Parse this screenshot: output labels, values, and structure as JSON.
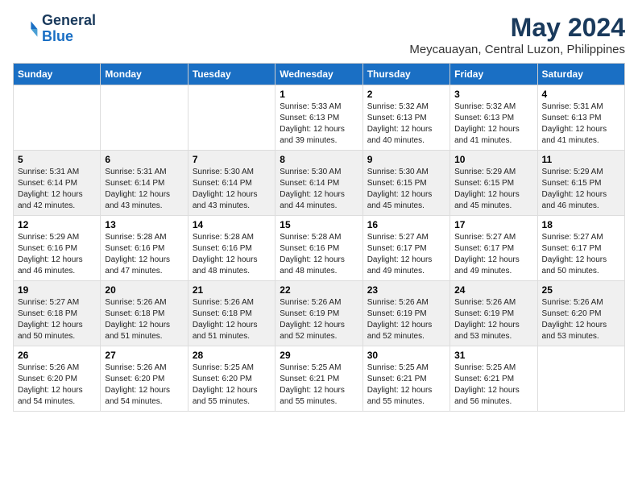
{
  "header": {
    "logo_line1": "General",
    "logo_line2": "Blue",
    "title": "May 2024",
    "subtitle": "Meycauayan, Central Luzon, Philippines"
  },
  "calendar": {
    "weekdays": [
      "Sunday",
      "Monday",
      "Tuesday",
      "Wednesday",
      "Thursday",
      "Friday",
      "Saturday"
    ],
    "rows": [
      [
        {
          "day": "",
          "info": ""
        },
        {
          "day": "",
          "info": ""
        },
        {
          "day": "",
          "info": ""
        },
        {
          "day": "1",
          "info": "Sunrise: 5:33 AM\nSunset: 6:13 PM\nDaylight: 12 hours\nand 39 minutes."
        },
        {
          "day": "2",
          "info": "Sunrise: 5:32 AM\nSunset: 6:13 PM\nDaylight: 12 hours\nand 40 minutes."
        },
        {
          "day": "3",
          "info": "Sunrise: 5:32 AM\nSunset: 6:13 PM\nDaylight: 12 hours\nand 41 minutes."
        },
        {
          "day": "4",
          "info": "Sunrise: 5:31 AM\nSunset: 6:13 PM\nDaylight: 12 hours\nand 41 minutes."
        }
      ],
      [
        {
          "day": "5",
          "info": "Sunrise: 5:31 AM\nSunset: 6:14 PM\nDaylight: 12 hours\nand 42 minutes."
        },
        {
          "day": "6",
          "info": "Sunrise: 5:31 AM\nSunset: 6:14 PM\nDaylight: 12 hours\nand 43 minutes."
        },
        {
          "day": "7",
          "info": "Sunrise: 5:30 AM\nSunset: 6:14 PM\nDaylight: 12 hours\nand 43 minutes."
        },
        {
          "day": "8",
          "info": "Sunrise: 5:30 AM\nSunset: 6:14 PM\nDaylight: 12 hours\nand 44 minutes."
        },
        {
          "day": "9",
          "info": "Sunrise: 5:30 AM\nSunset: 6:15 PM\nDaylight: 12 hours\nand 45 minutes."
        },
        {
          "day": "10",
          "info": "Sunrise: 5:29 AM\nSunset: 6:15 PM\nDaylight: 12 hours\nand 45 minutes."
        },
        {
          "day": "11",
          "info": "Sunrise: 5:29 AM\nSunset: 6:15 PM\nDaylight: 12 hours\nand 46 minutes."
        }
      ],
      [
        {
          "day": "12",
          "info": "Sunrise: 5:29 AM\nSunset: 6:16 PM\nDaylight: 12 hours\nand 46 minutes."
        },
        {
          "day": "13",
          "info": "Sunrise: 5:28 AM\nSunset: 6:16 PM\nDaylight: 12 hours\nand 47 minutes."
        },
        {
          "day": "14",
          "info": "Sunrise: 5:28 AM\nSunset: 6:16 PM\nDaylight: 12 hours\nand 48 minutes."
        },
        {
          "day": "15",
          "info": "Sunrise: 5:28 AM\nSunset: 6:16 PM\nDaylight: 12 hours\nand 48 minutes."
        },
        {
          "day": "16",
          "info": "Sunrise: 5:27 AM\nSunset: 6:17 PM\nDaylight: 12 hours\nand 49 minutes."
        },
        {
          "day": "17",
          "info": "Sunrise: 5:27 AM\nSunset: 6:17 PM\nDaylight: 12 hours\nand 49 minutes."
        },
        {
          "day": "18",
          "info": "Sunrise: 5:27 AM\nSunset: 6:17 PM\nDaylight: 12 hours\nand 50 minutes."
        }
      ],
      [
        {
          "day": "19",
          "info": "Sunrise: 5:27 AM\nSunset: 6:18 PM\nDaylight: 12 hours\nand 50 minutes."
        },
        {
          "day": "20",
          "info": "Sunrise: 5:26 AM\nSunset: 6:18 PM\nDaylight: 12 hours\nand 51 minutes."
        },
        {
          "day": "21",
          "info": "Sunrise: 5:26 AM\nSunset: 6:18 PM\nDaylight: 12 hours\nand 51 minutes."
        },
        {
          "day": "22",
          "info": "Sunrise: 5:26 AM\nSunset: 6:19 PM\nDaylight: 12 hours\nand 52 minutes."
        },
        {
          "day": "23",
          "info": "Sunrise: 5:26 AM\nSunset: 6:19 PM\nDaylight: 12 hours\nand 52 minutes."
        },
        {
          "day": "24",
          "info": "Sunrise: 5:26 AM\nSunset: 6:19 PM\nDaylight: 12 hours\nand 53 minutes."
        },
        {
          "day": "25",
          "info": "Sunrise: 5:26 AM\nSunset: 6:20 PM\nDaylight: 12 hours\nand 53 minutes."
        }
      ],
      [
        {
          "day": "26",
          "info": "Sunrise: 5:26 AM\nSunset: 6:20 PM\nDaylight: 12 hours\nand 54 minutes."
        },
        {
          "day": "27",
          "info": "Sunrise: 5:26 AM\nSunset: 6:20 PM\nDaylight: 12 hours\nand 54 minutes."
        },
        {
          "day": "28",
          "info": "Sunrise: 5:25 AM\nSunset: 6:20 PM\nDaylight: 12 hours\nand 55 minutes."
        },
        {
          "day": "29",
          "info": "Sunrise: 5:25 AM\nSunset: 6:21 PM\nDaylight: 12 hours\nand 55 minutes."
        },
        {
          "day": "30",
          "info": "Sunrise: 5:25 AM\nSunset: 6:21 PM\nDaylight: 12 hours\nand 55 minutes."
        },
        {
          "day": "31",
          "info": "Sunrise: 5:25 AM\nSunset: 6:21 PM\nDaylight: 12 hours\nand 56 minutes."
        },
        {
          "day": "",
          "info": ""
        }
      ]
    ]
  }
}
